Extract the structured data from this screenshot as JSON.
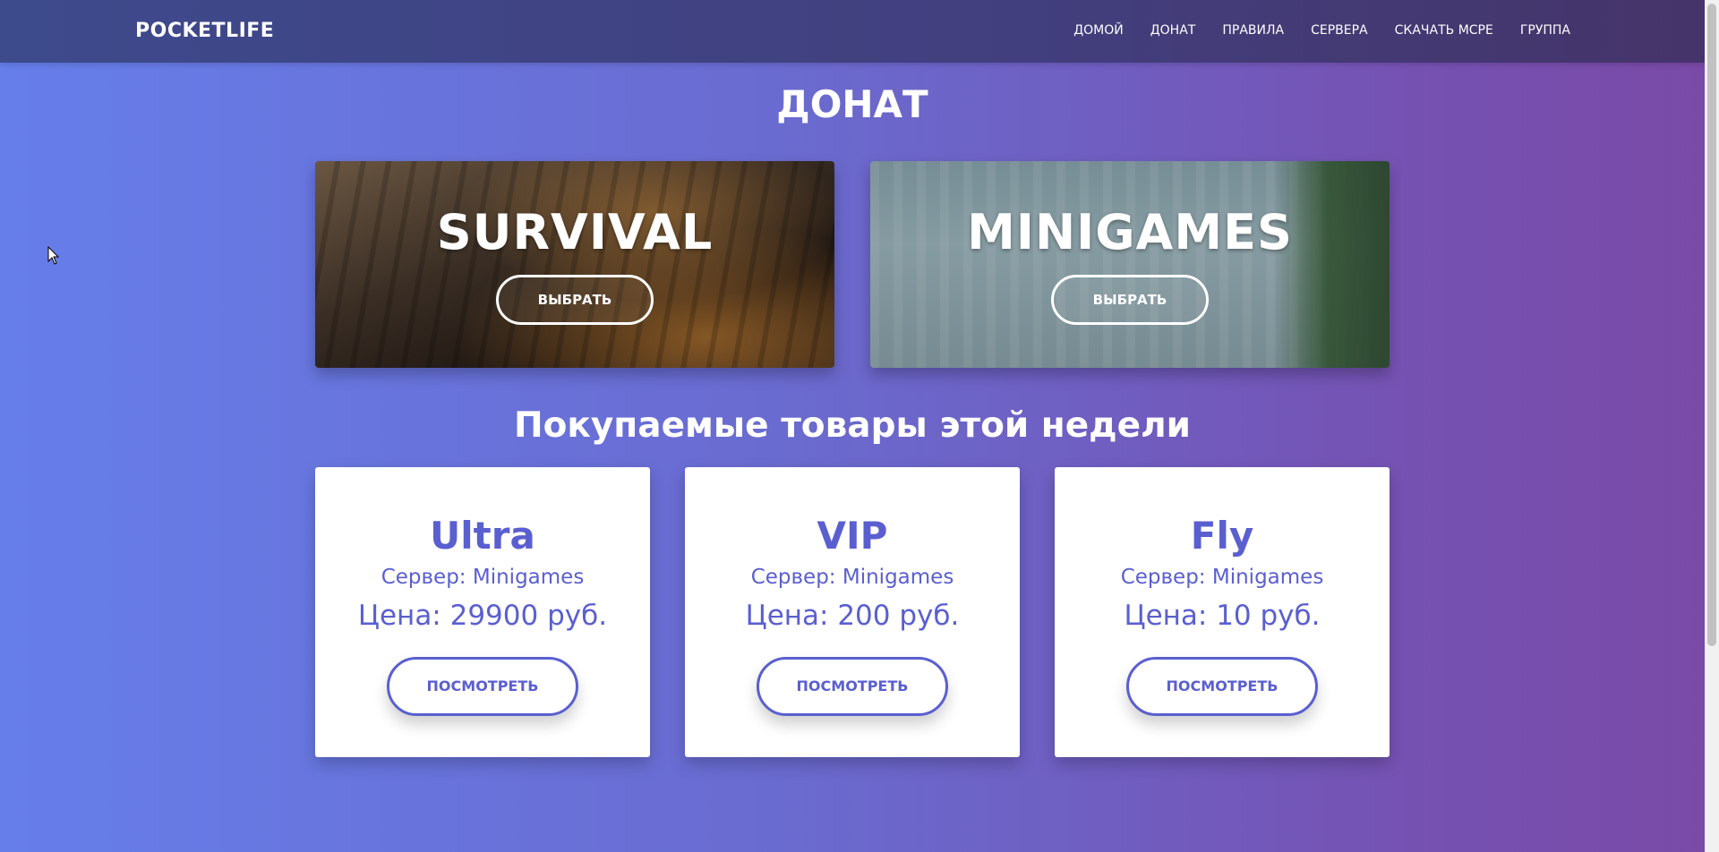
{
  "navbar": {
    "brand": "POCKETLIFE",
    "links": [
      "ДОМОЙ",
      "ДОНАТ",
      "ПРАВИЛА",
      "СЕРВЕРА",
      "СКАЧАТЬ MCPE",
      "ГРУППА"
    ]
  },
  "page_title": "ДОНАТ",
  "servers": [
    {
      "name": "SURVIVAL",
      "button": "ВЫБРАТЬ"
    },
    {
      "name": "MINIGAMES",
      "button": "ВЫБРАТЬ"
    }
  ],
  "section_title": "Покупаемые товары этой недели",
  "products": [
    {
      "name": "Ultra",
      "server": "Сервер: Minigames",
      "price": "Цена: 29900 руб.",
      "button": "ПОСМОТРЕТЬ"
    },
    {
      "name": "VIP",
      "server": "Сервер: Minigames",
      "price": "Цена: 200 руб.",
      "button": "ПОСМОТРЕТЬ"
    },
    {
      "name": "Fly",
      "server": "Сервер: Minigames",
      "price": "Цена: 10 руб.",
      "button": "ПОСМОТРЕТЬ"
    }
  ],
  "colors": {
    "accent": "#5a5fd0",
    "nav_bg": "#423f7e",
    "gradient_start": "#667eea",
    "gradient_end": "#7a4aa6"
  }
}
